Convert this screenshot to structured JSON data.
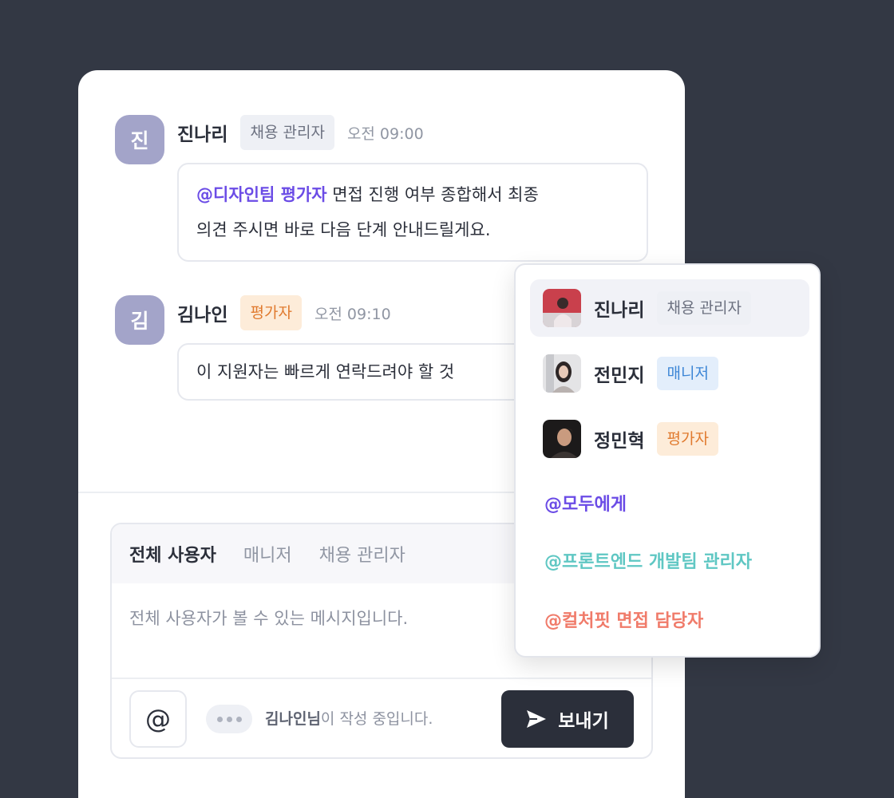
{
  "messages": [
    {
      "avatar_letter": "진",
      "name": "진나리",
      "role": "채용 관리자",
      "time": "오전 09:00",
      "mention": "@디자인팀 평가자",
      "text_line1": " 면접 진행 여부 종합해서 최종",
      "text_line2": "의견 주시면 바로 다음 단계 안내드릴게요."
    },
    {
      "avatar_letter": "김",
      "name": "김나인",
      "role": "평가자",
      "time": "오전 09:10",
      "text": "이 지원자는 빠르게 연락드려야 할 것"
    }
  ],
  "composer": {
    "tabs": [
      "전체 사용자",
      "매니저",
      "채용 관리자"
    ],
    "active_tab": "전체 사용자",
    "placeholder": "전체 사용자가 볼 수 있는 메시지입니다.",
    "at_button": "@",
    "typing_name": "김나인님",
    "typing_suffix": "이 작성 중입니다.",
    "send_label": "보내기"
  },
  "mention_dropdown": {
    "users": [
      {
        "name": "진나리",
        "role": "채용 관리자",
        "role_type": "admin",
        "selected": true,
        "photo": "woman-red-background"
      },
      {
        "name": "전민지",
        "role": "매니저",
        "role_type": "manager",
        "selected": false,
        "photo": "woman-light-background"
      },
      {
        "name": "정민혁",
        "role": "평가자",
        "role_type": "evaluator",
        "selected": false,
        "photo": "man-dark-background"
      }
    ],
    "groups": [
      {
        "label": "@모두에게",
        "color": "#6b4ce6"
      },
      {
        "label": "@프론트엔드 개발팀 관리자",
        "color": "#5fc7c3"
      },
      {
        "label": "@컬처핏 면접 담당자",
        "color": "#f07b6a"
      }
    ]
  },
  "colors": {
    "background": "#333844",
    "mention": "#6b4ce6",
    "send_button": "#2b2f3a",
    "avatar": "#a3a4c9"
  }
}
